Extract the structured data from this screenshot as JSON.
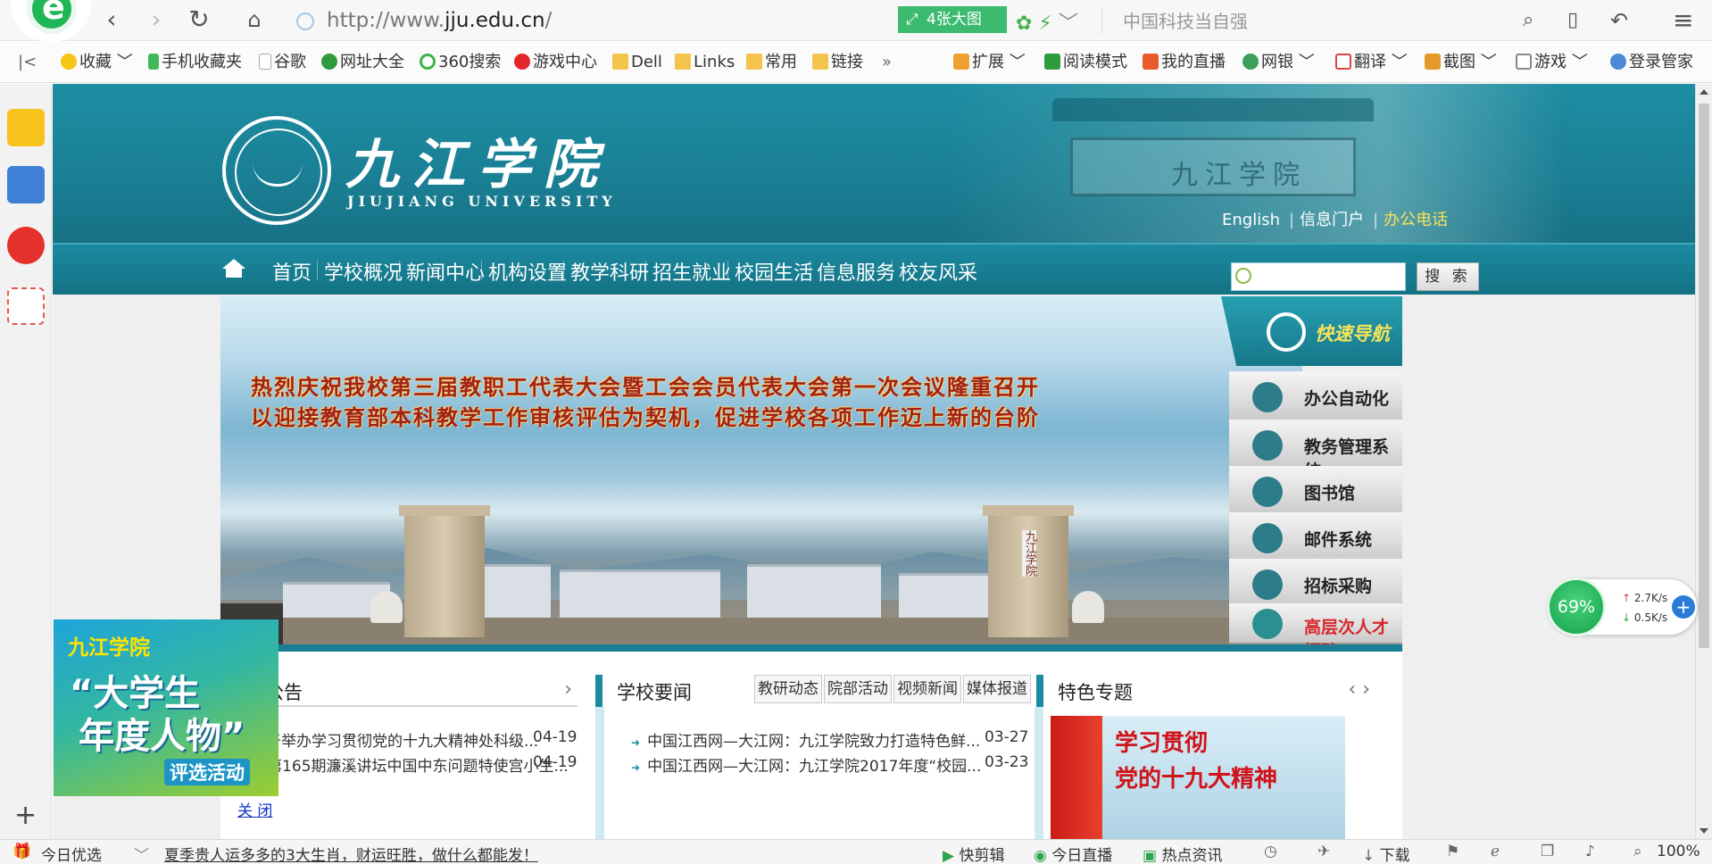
{
  "browser": {
    "url_prefix": "http://www.",
    "url_domain": "jju.edu.cn",
    "url_suffix": "/",
    "big_pic_label": "4张大图",
    "search_hint": "中国科技当自强"
  },
  "favorites": [
    {
      "label": "收藏"
    },
    {
      "label": "手机收藏夹"
    },
    {
      "label": "谷歌"
    },
    {
      "label": "网址大全"
    },
    {
      "label": "360搜索"
    },
    {
      "label": "游戏中心"
    },
    {
      "label": "Dell"
    },
    {
      "label": "Links"
    },
    {
      "label": "常用"
    },
    {
      "label": "链接"
    }
  ],
  "extensions": [
    {
      "label": "扩展"
    },
    {
      "label": "阅读模式"
    },
    {
      "label": "我的直播"
    },
    {
      "label": "网银"
    },
    {
      "label": "翻译"
    },
    {
      "label": "截图"
    },
    {
      "label": "游戏"
    },
    {
      "label": "登录管家"
    }
  ],
  "site": {
    "name_cn": "九江学院",
    "name_en": "JIUJIANG   UNIVERSITY",
    "gate_text": "九江学院",
    "top_links": {
      "english": "English",
      "portal": "信息门户",
      "phone": "办公电话"
    },
    "nav": [
      "首页",
      "学校概况",
      "新闻中心",
      "机构设置",
      "教学科研",
      "招生就业",
      "校园生活",
      "信息服务",
      "校友风采"
    ],
    "search_button": "搜 索",
    "banner_line1": "热烈庆祝我校第三届教职工代表大会暨工会会员代表大会第一次会议隆重召开",
    "banner_line2": "以迎接教育部本科教学工作审核评估为契机，促进学校各项工作迈上新的台阶",
    "pillar_text": "九江学院",
    "quick_nav": {
      "title": "快速导航",
      "items": [
        "办公自动化",
        "教务管理系统",
        "图书馆",
        "邮件系统",
        "招标采购",
        "高层次人才招聘"
      ]
    },
    "notice": {
      "title": "公告",
      "items": [
        {
          "text": "关于举办学习贯彻党的十九大精神处科级...",
          "date": "04-19"
        },
        {
          "text": "第165期濂溪讲坛中国中东问题特使宫小生...",
          "date": "04-19"
        }
      ]
    },
    "news": {
      "title": "学校要闻",
      "tabs": [
        "教研动态",
        "院部活动",
        "视频新闻",
        "媒体报道"
      ],
      "items": [
        {
          "text": "中国江西网—大江网：九江学院致力打造特色鲜...",
          "date": "03-27"
        },
        {
          "text": "中国江西网—大江网：九江学院2017年度“校园...",
          "date": "03-23"
        }
      ]
    },
    "feature": {
      "title": "特色专题",
      "img_line1": "学习贯彻",
      "img_line2": "党的十九大精神"
    },
    "popup": {
      "line1": "九江学院",
      "line2": "“大学生",
      "line3": "年度人物”",
      "line4": "评选活动",
      "close": "关 闭"
    }
  },
  "speed_widget": {
    "percent": "69%",
    "up": "2.7K/s",
    "down": "0.5K/s"
  },
  "statusbar": {
    "today_pick": "今日优选",
    "headline": "夏季贵人运多多的3大生肖，财运旺胜，做什么都能发！",
    "quick_cut": "快剪辑",
    "live": "今日直播",
    "hot_news": "热点资讯",
    "download": "下载",
    "zoom": "100%"
  }
}
